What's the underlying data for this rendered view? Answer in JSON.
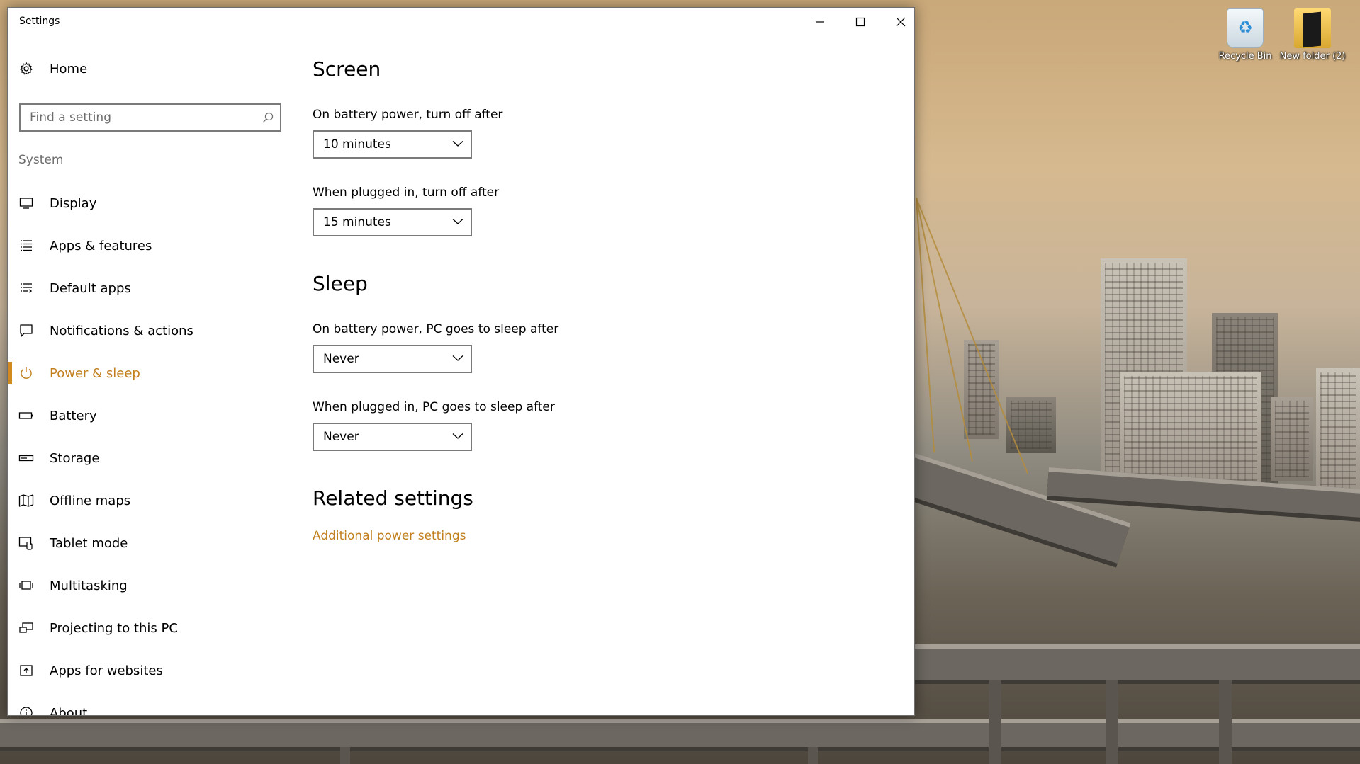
{
  "window": {
    "title": "Settings",
    "minimize_icon": "minimize-icon",
    "maximize_icon": "maximize-icon",
    "close_icon": "close-icon"
  },
  "sidebar": {
    "home": {
      "label": "Home",
      "icon": "gear-icon"
    },
    "search": {
      "placeholder": "Find a setting",
      "value": "",
      "icon": "search-icon"
    },
    "group_label": "System",
    "items": [
      {
        "label": "Display",
        "icon": "monitor-icon",
        "selected": false
      },
      {
        "label": "Apps & features",
        "icon": "list-icon",
        "selected": false
      },
      {
        "label": "Default apps",
        "icon": "default-apps-icon",
        "selected": false
      },
      {
        "label": "Notifications & actions",
        "icon": "notification-icon",
        "selected": false
      },
      {
        "label": "Power & sleep",
        "icon": "power-icon",
        "selected": true
      },
      {
        "label": "Battery",
        "icon": "battery-icon",
        "selected": false
      },
      {
        "label": "Storage",
        "icon": "storage-icon",
        "selected": false
      },
      {
        "label": "Offline maps",
        "icon": "map-icon",
        "selected": false
      },
      {
        "label": "Tablet mode",
        "icon": "tablet-mode-icon",
        "selected": false
      },
      {
        "label": "Multitasking",
        "icon": "multitasking-icon",
        "selected": false
      },
      {
        "label": "Projecting to this PC",
        "icon": "projecting-icon",
        "selected": false
      },
      {
        "label": "Apps for websites",
        "icon": "apps-for-websites-icon",
        "selected": false
      },
      {
        "label": "About",
        "icon": "info-icon",
        "selected": false
      }
    ]
  },
  "main": {
    "screen": {
      "title": "Screen",
      "battery_label": "On battery power, turn off after",
      "battery_value": "10 minutes",
      "plugged_label": "When plugged in, turn off after",
      "plugged_value": "15 minutes"
    },
    "sleep": {
      "title": "Sleep",
      "battery_label": "On battery power, PC goes to sleep after",
      "battery_value": "Never",
      "plugged_label": "When plugged in, PC goes to sleep after",
      "plugged_value": "Never"
    },
    "related": {
      "title": "Related settings",
      "link": "Additional power settings"
    }
  },
  "desktop": {
    "icons": [
      {
        "label": "Recycle Bin",
        "icon": "recycle-bin-icon"
      },
      {
        "label": "New folder (2)",
        "icon": "folder-icon"
      }
    ]
  },
  "colors": {
    "accent": "#c17f1d",
    "window_bg": "#ffffff",
    "border": "#7a7a7a"
  }
}
